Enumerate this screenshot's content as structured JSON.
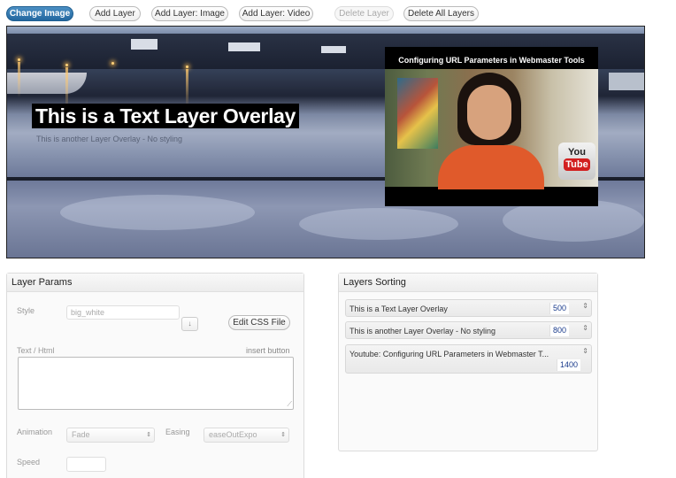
{
  "toolbar": {
    "change_image": "Change Image",
    "add_layer": "Add Layer",
    "add_layer_image": "Add Layer: Image",
    "add_layer_video": "Add Layer: Video",
    "delete_layer": "Delete Layer",
    "delete_all_layers": "Delete All Layers"
  },
  "stage": {
    "text_layer": "This is a Text Layer Overlay",
    "text_layer_2": "This is another Layer Overlay - No styling",
    "video": {
      "title": "Configuring URL Parameters in Webmaster Tools",
      "logo_you": "You",
      "logo_tube": "Tube"
    }
  },
  "layer_params": {
    "header": "Layer Params",
    "style_label": "Style",
    "style_value": "big_white",
    "style_arrow": "↓",
    "edit_css": "Edit CSS File",
    "text_label": "Text / Html",
    "insert_button": "insert button",
    "animation_label": "Animation",
    "animation_value": "Fade",
    "easing_label": "Easing",
    "easing_value": "easeOutExpo",
    "speed_label": "Speed"
  },
  "layers_sorting": {
    "header": "Layers Sorting",
    "items": [
      {
        "label": "This is a Text Layer Overlay",
        "value": "500"
      },
      {
        "label": "This is another Layer Overlay - No styling",
        "value": "800"
      },
      {
        "label": "Youtube: Configuring URL Parameters in Webmaster T...",
        "value": "1400"
      }
    ]
  },
  "colors": {
    "primary_button": "#2a6fa8",
    "text_layer_bg": "#000000",
    "sort_value": "#1a3b8c"
  }
}
